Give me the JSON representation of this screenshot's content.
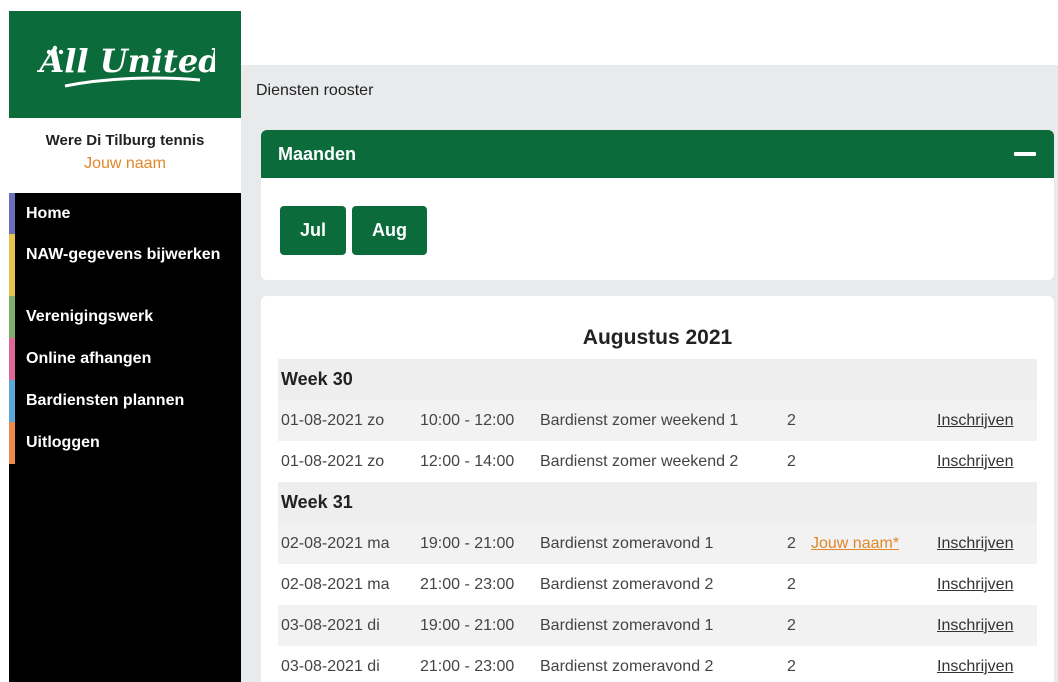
{
  "sidebar": {
    "logo_text": "All United",
    "club_name": "Were Di Tilburg tennis",
    "user_name": "Jouw naam",
    "items": [
      {
        "label": "Home",
        "color": "#6a6fc0"
      },
      {
        "label": "NAW-gegevens bijwerken",
        "color": "#e8c34a"
      },
      {
        "label": "Verenigingswerk",
        "color": "#7fb06a"
      },
      {
        "label": "Online afhangen",
        "color": "#e0679a"
      },
      {
        "label": "Bardiensten plannen",
        "color": "#5aa7d8"
      },
      {
        "label": "Uitloggen",
        "color": "#ee8a4a"
      }
    ]
  },
  "breadcrumb": "Diensten rooster",
  "months": {
    "title": "Maanden",
    "buttons": [
      "Jul",
      "Aug"
    ]
  },
  "schedule": {
    "month_title": "Augustus 2021",
    "action_label": "Inschrijven",
    "weeks": [
      {
        "label": "Week 30",
        "shifts": [
          {
            "date": "01-08-2021 zo",
            "time": "10:00 - 12:00",
            "name": "Bardienst zomer weekend 1",
            "count": "2",
            "volunteer": ""
          },
          {
            "date": "01-08-2021 zo",
            "time": "12:00 - 14:00",
            "name": "Bardienst zomer weekend 2",
            "count": "2",
            "volunteer": ""
          }
        ]
      },
      {
        "label": "Week 31",
        "shifts": [
          {
            "date": "02-08-2021 ma",
            "time": "19:00 - 21:00",
            "name": "Bardienst zomeravond 1",
            "count": "2",
            "volunteer": "Jouw naam*"
          },
          {
            "date": "02-08-2021 ma",
            "time": "21:00 - 23:00",
            "name": "Bardienst zomeravond 2",
            "count": "2",
            "volunteer": ""
          },
          {
            "date": "03-08-2021 di",
            "time": "19:00 - 21:00",
            "name": "Bardienst zomeravond 1",
            "count": "2",
            "volunteer": ""
          },
          {
            "date": "03-08-2021 di",
            "time": "21:00 - 23:00",
            "name": "Bardienst zomeravond 2",
            "count": "2",
            "volunteer": ""
          }
        ]
      }
    ]
  },
  "colors": {
    "brand_green": "#0b6b3a",
    "accent_orange": "#e0872a"
  }
}
